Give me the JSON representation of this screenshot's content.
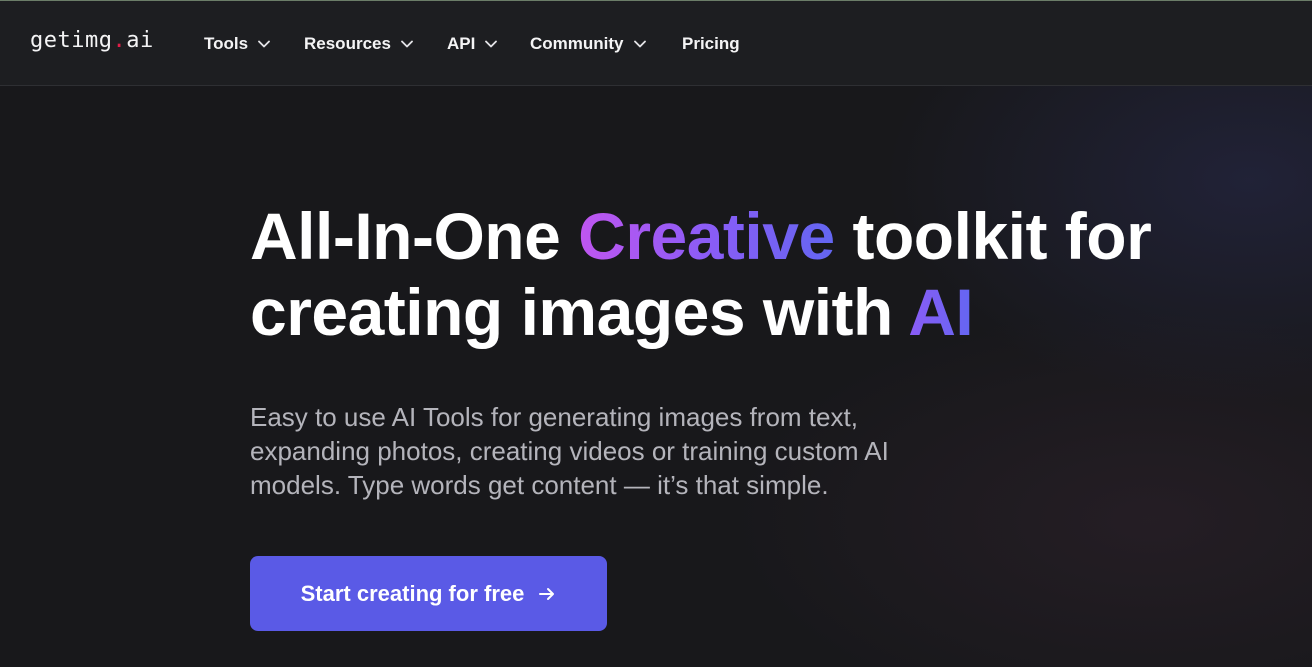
{
  "header": {
    "logo": {
      "prefix": "getimg",
      "dot": ".",
      "suffix": "ai"
    },
    "nav": [
      {
        "label": "Tools",
        "has_dropdown": true
      },
      {
        "label": "Resources",
        "has_dropdown": true
      },
      {
        "label": "API",
        "has_dropdown": true
      },
      {
        "label": "Community",
        "has_dropdown": true
      },
      {
        "label": "Pricing",
        "has_dropdown": false
      }
    ]
  },
  "hero": {
    "title": {
      "part1": "All-In-One ",
      "highlight1": "Creative",
      "part2": " toolkit for",
      "part3": "creating images with ",
      "highlight2": "AI"
    },
    "description": "Easy to use AI Tools for generating images from text, expanding photos, creating videos or training custom AI models. Type words get content — it’s that simple.",
    "cta_label": "Start creating for free",
    "cta_icon": "arrow-right-icon"
  },
  "colors": {
    "background": "#18181b",
    "navbar": "#1d1e21",
    "cta": "#5a5ae6",
    "gradient_start": "#c056f0",
    "gradient_end": "#6366f1",
    "logo_dot": "#e11d48"
  }
}
